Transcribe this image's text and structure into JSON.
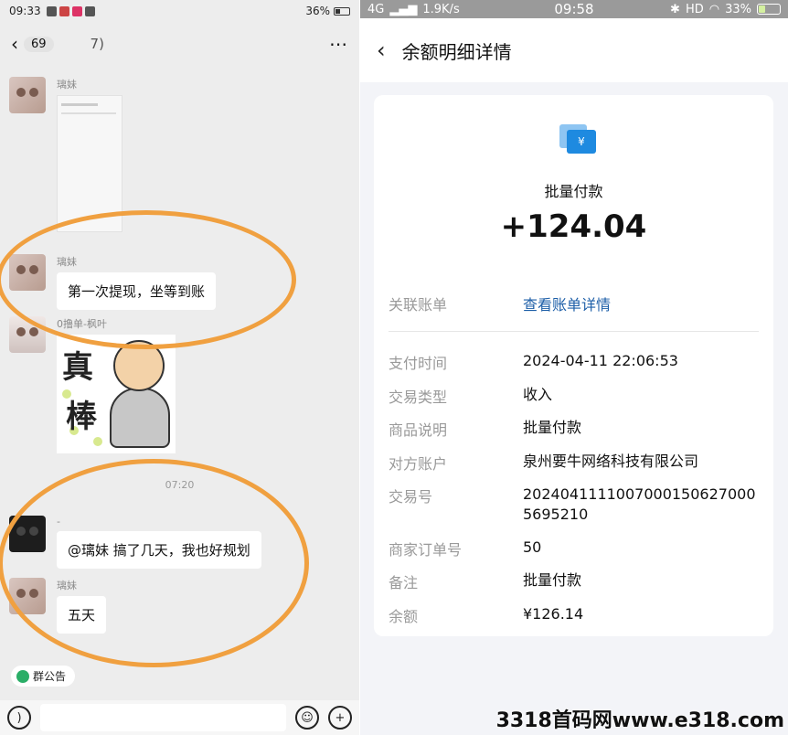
{
  "left": {
    "status_time": "09:33",
    "battery": "36%",
    "unread_count": "69",
    "chat_title": "7)",
    "messages": [
      {
        "sender": "璃妹"
      },
      {
        "sender": "璃妹",
        "text": "第一次提现，坐等到账"
      },
      {
        "sender": "0撸单-枫叶"
      },
      {
        "sender": "-",
        "text": "@璃妹  搞了几天，我也好规划"
      },
      {
        "sender": "璃妹",
        "text": "五天"
      }
    ],
    "time_divider": "07:20",
    "notice_label": "群公告"
  },
  "right": {
    "status_network": "4G",
    "status_speed": "1.9K/s",
    "status_time": "09:58",
    "status_hd": "HD",
    "battery": "33%",
    "page_title": "余额明细详情",
    "pay_name": "批量付款",
    "amount": "+124.04",
    "related_label": "关联账单",
    "related_link": "查看账单详情",
    "details": [
      {
        "label": "支付时间",
        "value": "2024-04-11 22:06:53"
      },
      {
        "label": "交易类型",
        "value": "收入"
      },
      {
        "label": "商品说明",
        "value": "批量付款"
      },
      {
        "label": "对方账户",
        "value": "泉州要牛网络科技有限公司"
      },
      {
        "label": "交易号",
        "value": "2024041111007000150627000 5695210"
      },
      {
        "label": "商家订单号",
        "value": "50"
      },
      {
        "label": "备注",
        "value": "批量付款"
      },
      {
        "label": "余额",
        "value": "¥126.14"
      }
    ]
  },
  "watermark": "3318首码网www.e318.com",
  "accent_colors": {
    "highlight_circle": "#f0a040",
    "link": "#1e5fa8",
    "pay_icon": "#1e8ae0"
  }
}
